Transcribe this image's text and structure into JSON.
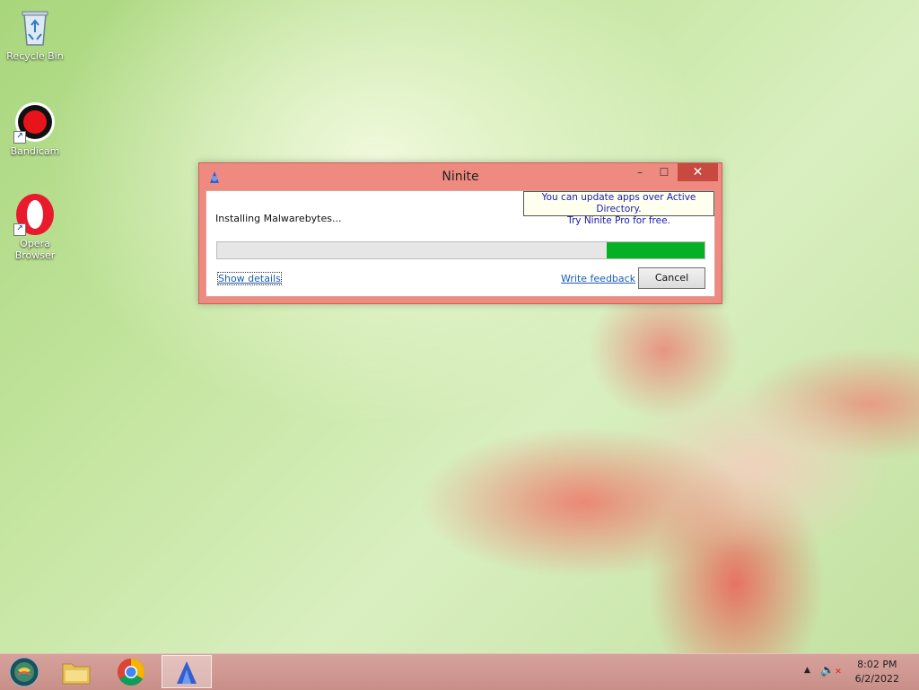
{
  "desktop": {
    "icons": [
      {
        "label": "Recycle Bin",
        "icon": "recycle-bin-icon"
      },
      {
        "label": "Bandicam",
        "icon": "bandicam-icon"
      },
      {
        "label": "Opera\nBrowser",
        "icon": "opera-icon"
      }
    ]
  },
  "window": {
    "title": "Ninite",
    "controls": {
      "minimize": "–",
      "maximize": "☐",
      "close": "✕"
    },
    "promo_line1": "You can update apps over Active Directory.",
    "promo_line2": "Try Ninite Pro for free.",
    "status": "Installing Malwarebytes...",
    "progress_fraction": 0.2,
    "show_details": "Show details",
    "write_feedback": "Write feedback",
    "cancel": "Cancel"
  },
  "taskbar": {
    "items": [
      "start-orb",
      "file-explorer",
      "chrome",
      "ninite"
    ],
    "tray": {
      "time": "8:02 PM",
      "date": "6/2/2022"
    }
  },
  "colors": {
    "progress_fill": "#06b025",
    "window_frame": "#ee8a7f",
    "close_button": "#c7493f",
    "link": "#1a5fb4"
  }
}
